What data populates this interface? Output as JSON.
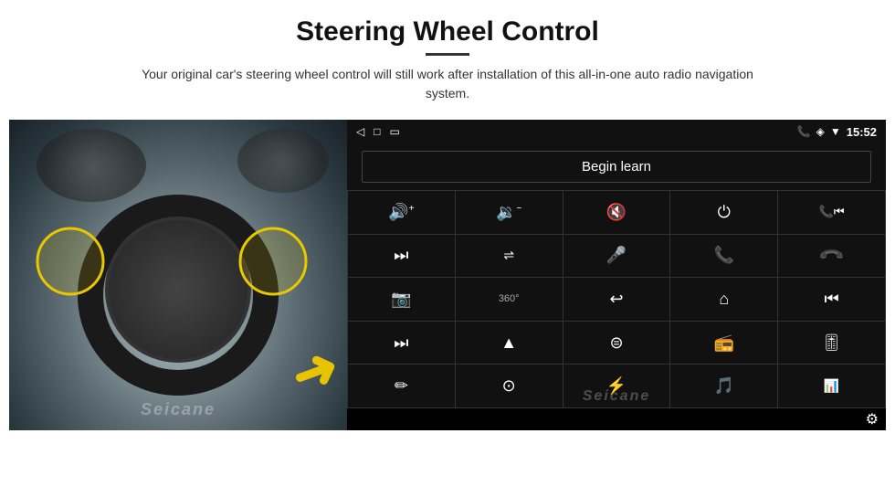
{
  "page": {
    "title": "Steering Wheel Control",
    "subtitle": "Your original car's steering wheel control will still work after installation of this all-in-one auto radio navigation system.",
    "title_underline": true
  },
  "status_bar": {
    "back_icon": "◁",
    "home_icon": "□",
    "recents_icon": "▭",
    "signal_icon": "▮▮",
    "wifi_icon": "▲",
    "phone_icon": "📞",
    "location_icon": "◈",
    "wifi2_icon": "▼",
    "time": "15:52"
  },
  "begin_learn": {
    "label": "Begin learn"
  },
  "controls": [
    {
      "id": "vol-up",
      "icon": "🔊+",
      "symbol": "vol_up"
    },
    {
      "id": "vol-down",
      "icon": "🔉-",
      "symbol": "vol_down"
    },
    {
      "id": "vol-mute",
      "icon": "🔇×",
      "symbol": "vol_mute"
    },
    {
      "id": "power",
      "icon": "⏻",
      "symbol": "power"
    },
    {
      "id": "prev-track-phone",
      "icon": "📞⏮",
      "symbol": "call_prev"
    },
    {
      "id": "next-track",
      "icon": "⏭",
      "symbol": "next_track"
    },
    {
      "id": "shuffle",
      "icon": "⇌⏭",
      "symbol": "shuffle"
    },
    {
      "id": "mic",
      "icon": "🎤",
      "symbol": "mic"
    },
    {
      "id": "phone",
      "icon": "📞",
      "symbol": "phone"
    },
    {
      "id": "hang-up",
      "icon": "📵",
      "symbol": "hang_up"
    },
    {
      "id": "camera",
      "icon": "📷",
      "symbol": "camera"
    },
    {
      "id": "360",
      "icon": "360°",
      "symbol": "360_view"
    },
    {
      "id": "back",
      "icon": "↩",
      "symbol": "back"
    },
    {
      "id": "home",
      "icon": "⌂",
      "symbol": "home"
    },
    {
      "id": "skip-back",
      "icon": "⏮⏮",
      "symbol": "skip_back"
    },
    {
      "id": "fast-forward",
      "icon": "⏭⏭",
      "symbol": "fast_forward"
    },
    {
      "id": "navigate",
      "icon": "▶",
      "symbol": "navigate"
    },
    {
      "id": "equalizer",
      "icon": "⊜",
      "symbol": "equalizer"
    },
    {
      "id": "radio",
      "icon": "📻",
      "symbol": "radio"
    },
    {
      "id": "mixer",
      "icon": "🎚",
      "symbol": "mixer"
    },
    {
      "id": "pen",
      "icon": "✏",
      "symbol": "pen"
    },
    {
      "id": "circle-btn",
      "icon": "⊙",
      "symbol": "circle"
    },
    {
      "id": "bluetooth",
      "icon": "⚡",
      "symbol": "bluetooth"
    },
    {
      "id": "music-note",
      "icon": "🎵",
      "symbol": "music"
    },
    {
      "id": "bars",
      "icon": "📊",
      "symbol": "equalizer_bars"
    }
  ],
  "bottom_bar": {
    "gear_icon": "⚙",
    "seicane_watermark": "Seicane"
  }
}
